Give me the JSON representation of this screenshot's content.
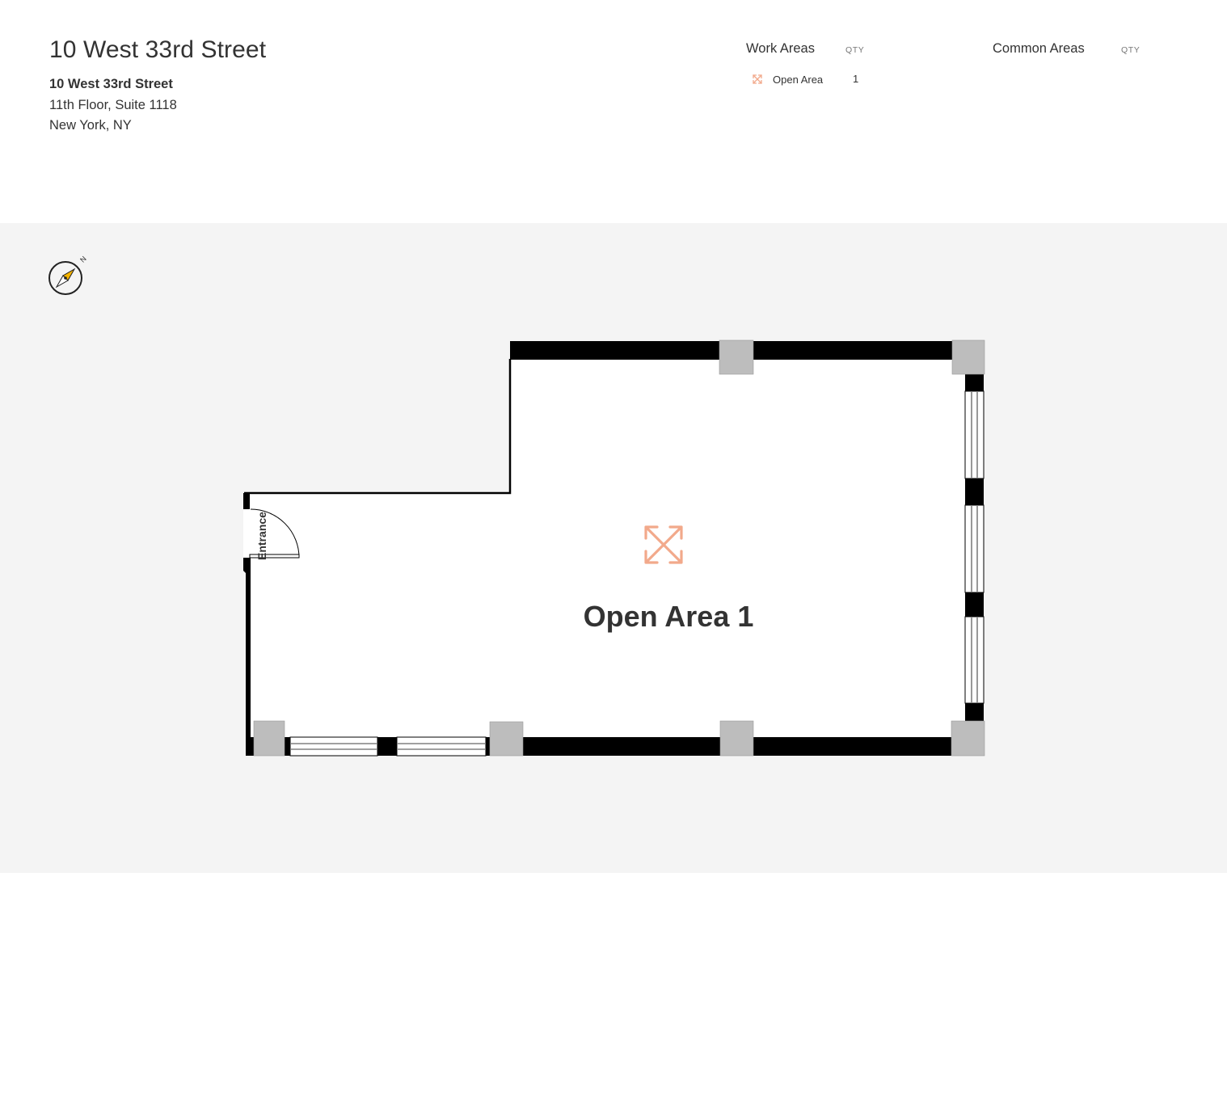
{
  "header": {
    "title": "10 West 33rd Street",
    "address_name": "10 West 33rd Street",
    "address_line1": "11th Floor, Suite 1118",
    "address_line2": "New York, NY"
  },
  "legend": {
    "work_areas": {
      "heading": "Work Areas",
      "qty_label": "QTY",
      "items": [
        {
          "icon": "open-area-icon",
          "label": "Open Area",
          "qty": "1"
        }
      ]
    },
    "common_areas": {
      "heading": "Common Areas",
      "qty_label": "QTY",
      "items": []
    }
  },
  "plan": {
    "compass_label": "N",
    "entrance_label": "Entrance",
    "room_label": "Open Area 1",
    "room_icon": "open-area-icon"
  },
  "colors": {
    "accent": "#f2a98b",
    "wall": "#000000",
    "column": "#bdbdbd",
    "background": "#f4f4f4",
    "compass_needle": "#f5b400"
  }
}
